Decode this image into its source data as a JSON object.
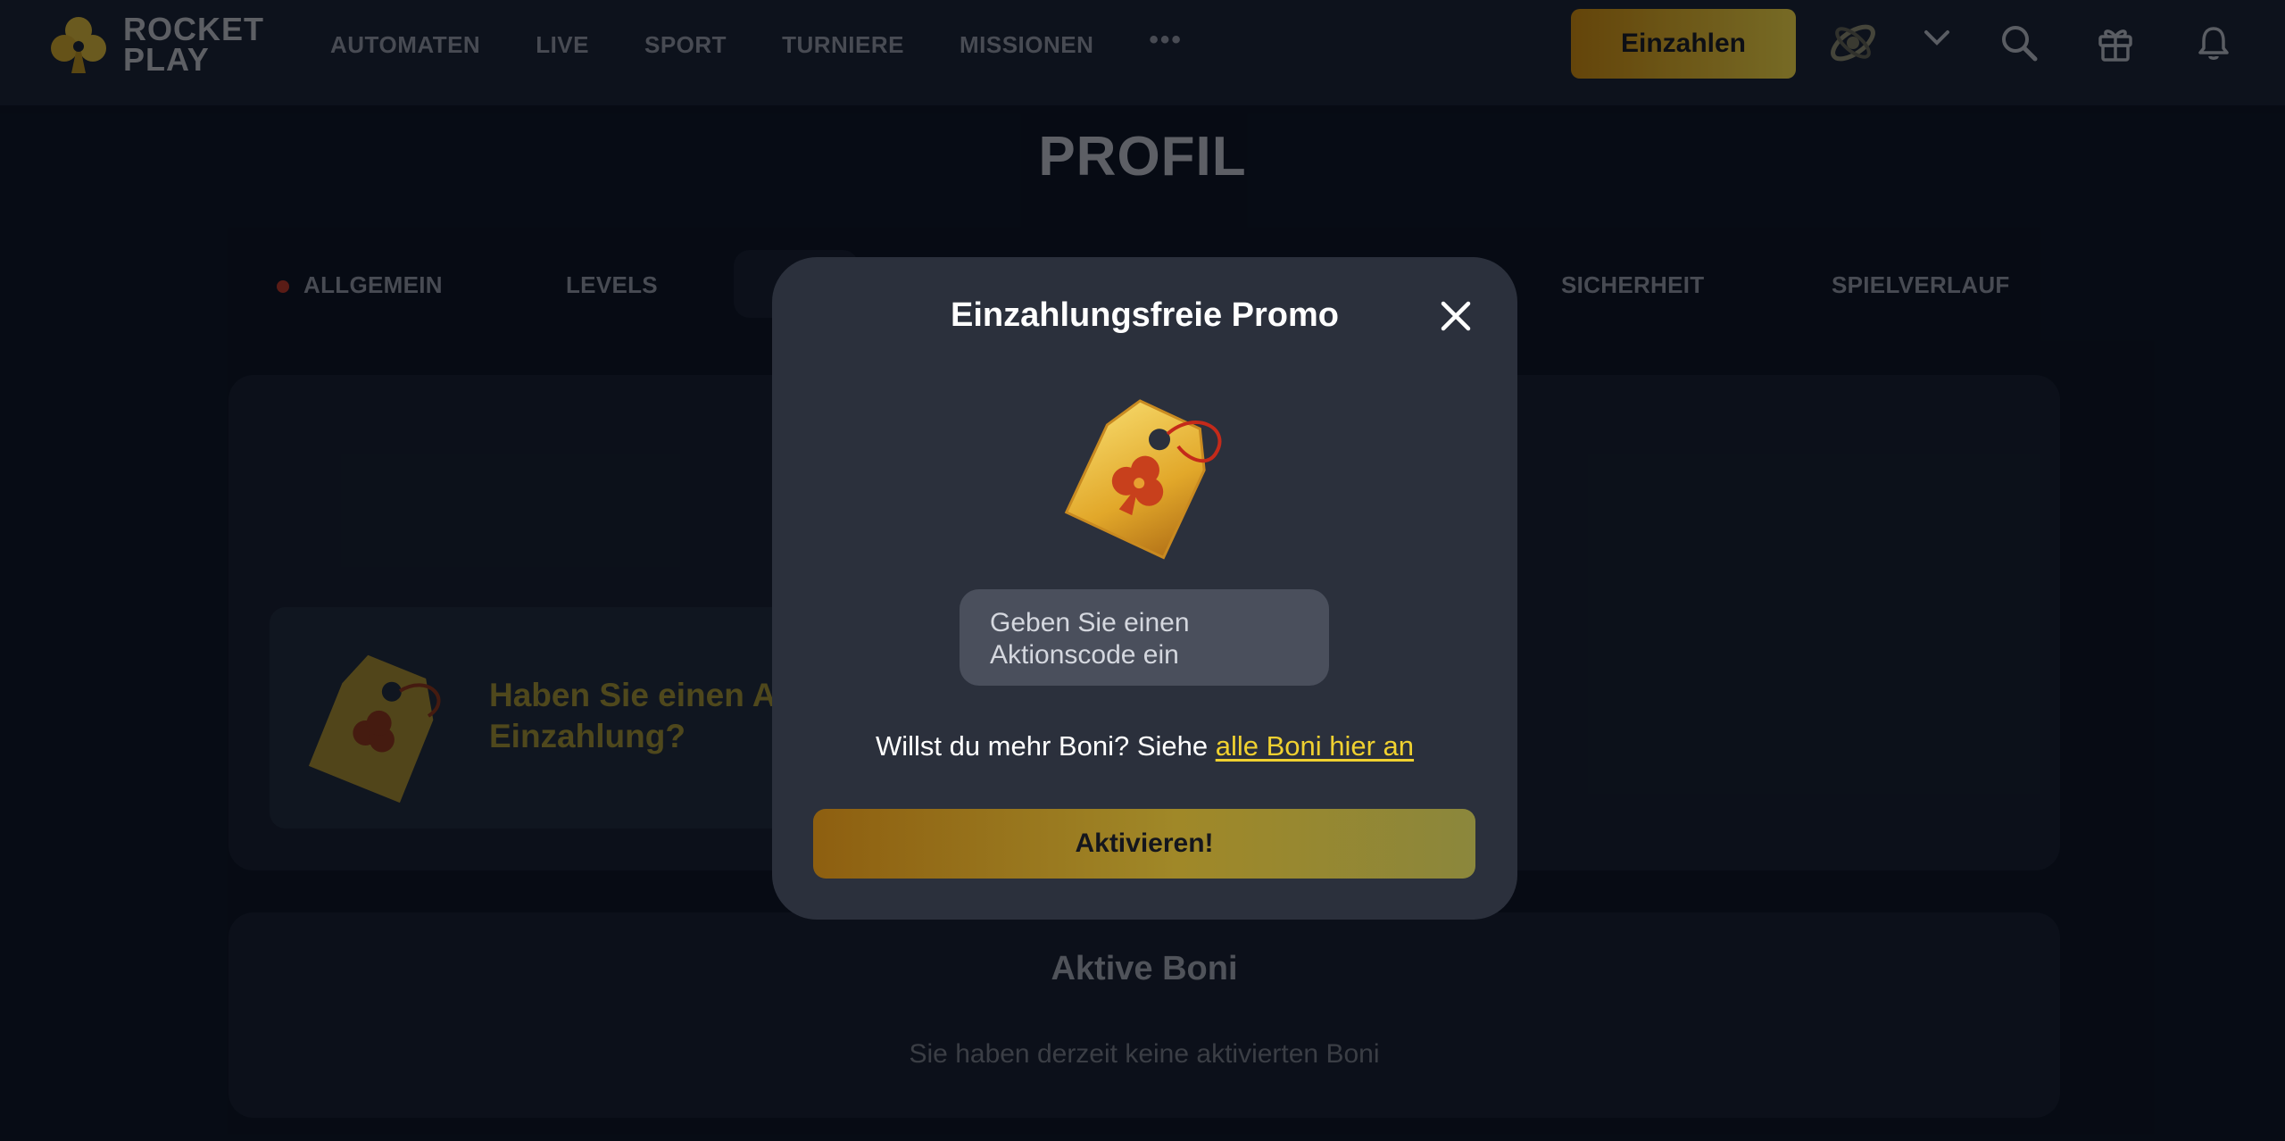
{
  "header": {
    "logo_line1": "ROCKET",
    "logo_line2": "PLAY",
    "nav": [
      "AUTOMATEN",
      "LIVE",
      "SPORT",
      "TURNIERE",
      "MISSIONEN"
    ],
    "more": "•••",
    "deposit_label": "Einzahlen"
  },
  "page": {
    "title": "PROFIL",
    "tabs": [
      "ALLGEMEIN",
      "LEVELS",
      "SICHERHEIT",
      "SPIELVERLAUF"
    ],
    "promo_strip_text": "Haben Sie einen A... Einzahlung?",
    "promo_strip_line1": "Haben Sie einen A",
    "promo_strip_line2": "Einzahlung?",
    "active_bonuses_title": "Aktive Boni",
    "active_bonuses_empty": "Sie haben derzeit keine aktivierten Boni"
  },
  "modal": {
    "title": "Einzahlungsfreie Promo",
    "input_placeholder_line1": "Geben Sie einen",
    "input_placeholder_line2": "Aktionscode ein",
    "more_text": "Willst du mehr Boni? Siehe ",
    "more_link": "alle Boni hier an",
    "activate_label": "Aktivieren!"
  },
  "colors": {
    "accent_gold": "#f0d130",
    "background": "#0b1220",
    "modal": "#2b303c"
  },
  "icons": [
    "club-logo-icon",
    "avatar-icon",
    "chevron-down-icon",
    "search-icon",
    "gift-icon",
    "bell-icon",
    "close-icon",
    "promo-tag-icon"
  ]
}
